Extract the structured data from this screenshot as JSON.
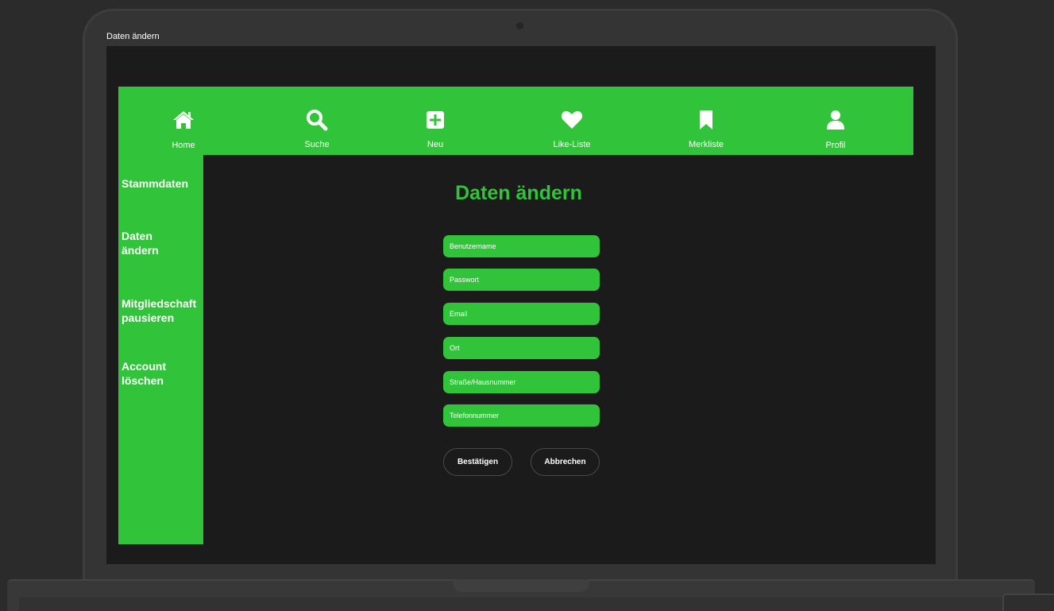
{
  "window": {
    "title": "Daten ändern"
  },
  "nav": {
    "items": [
      {
        "label": "Home",
        "icon": "home-icon"
      },
      {
        "label": "Suche",
        "icon": "search-icon"
      },
      {
        "label": "Neu",
        "icon": "plus-square-icon"
      },
      {
        "label": "Like-Liste",
        "icon": "heart-icon"
      },
      {
        "label": "Merkliste",
        "icon": "bookmark-icon"
      },
      {
        "label": "Profil",
        "icon": "user-icon"
      }
    ]
  },
  "sidebar": {
    "items": [
      {
        "label": "Stammdaten"
      },
      {
        "label": "Daten ändern"
      },
      {
        "label": "Mitgliedschaft pausieren"
      },
      {
        "label": "Account löschen"
      }
    ]
  },
  "form": {
    "title": "Daten ändern",
    "fields": [
      {
        "placeholder": "Benutzername",
        "value": ""
      },
      {
        "placeholder": "Passwort",
        "value": ""
      },
      {
        "placeholder": "Email",
        "value": ""
      },
      {
        "placeholder": "Ort",
        "value": ""
      },
      {
        "placeholder": "Straße/Hausnummer",
        "value": ""
      },
      {
        "placeholder": "Telefonnummer",
        "value": ""
      }
    ],
    "confirm_label": "Bestätigen",
    "cancel_label": "Abbrechen"
  },
  "colors": {
    "accent": "#31c43a",
    "background": "#1b1b1b",
    "text": "#ffffff"
  }
}
